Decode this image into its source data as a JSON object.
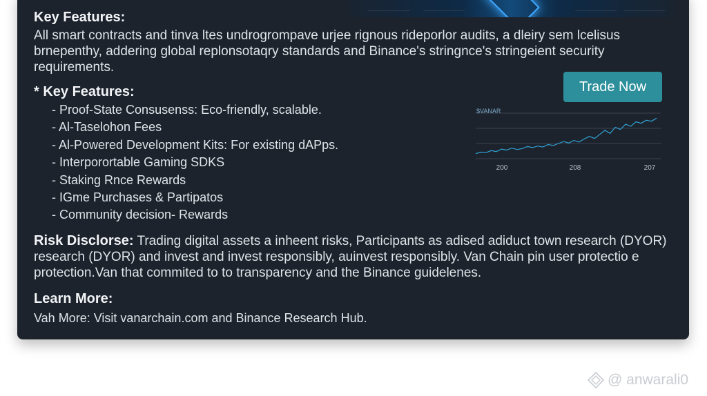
{
  "header_section": {
    "title": "Key Features:",
    "paragraph_line1": "All smart contracts and tinva ltes undrogrompave urjee rignous rideporlor audits, a dleiry sem lcelisus",
    "paragraph_line2": "brnepenthy, addering global replonsotaqry standards and Binance's stringnce's stringeient security",
    "paragraph_line3": "requirements."
  },
  "features": {
    "title": "* Key Features:",
    "items": [
      "- Proof-State Consusenss: Eco-friendly, scalable.",
      "- Al-Taselohon Fees",
      "- Al-Powered Development Kits: For existing dAPps.",
      "- Interporortable Gaming SDKS",
      "- Staking Rnce Rewards",
      "- IGme Purchases & Partipatos",
      "- Community decision- Rewards"
    ]
  },
  "risk": {
    "label": "Risk Disclorse:",
    "text1": " Trading digital assets a inheent risks, Participants as adised adiduct town research (DYOR)",
    "text2": "research (DYOR) and invest and invest responsibly, auinvest responsibly. Van Chain pin user protectio e",
    "text3": "protection.Van that commited to to transparency and the Binance guidelenes."
  },
  "learn_more": {
    "title": "Learn More:",
    "text": "Vah More: Visit vanarchain.com and Binance Research Hub."
  },
  "trade_button": {
    "label": "Trade Now"
  },
  "chart_data": {
    "type": "line",
    "title": "$VANAR",
    "x_tick_labels": [
      "200",
      "208",
      "207"
    ],
    "series": [
      {
        "values": [
          1.0,
          1.3,
          1.2,
          1.6,
          1.4,
          1.9,
          1.7,
          2.1,
          1.8,
          2.0,
          2.4,
          2.2,
          2.5,
          2.3,
          2.8,
          2.6,
          3.0,
          3.4,
          3.1,
          3.6,
          3.3,
          3.9,
          4.4,
          4.0,
          4.8,
          5.6,
          5.0,
          6.2,
          5.8,
          6.8,
          6.4,
          7.3,
          7.0,
          7.6,
          7.4,
          8.0
        ]
      }
    ],
    "ylim": [
      0,
      9
    ],
    "grid": true,
    "colors": {
      "line": "#2fa3d6",
      "grid": "#3a4350",
      "title": "#7aa9c8",
      "ticks": "#b9c1cb"
    }
  },
  "watermark": {
    "text": "@ anwarali0",
    "icon": "diamond-logo-icon"
  },
  "colors": {
    "card_bg": "#1d232c",
    "accent": "#2c8f9b",
    "text": "#dfe4ea"
  }
}
